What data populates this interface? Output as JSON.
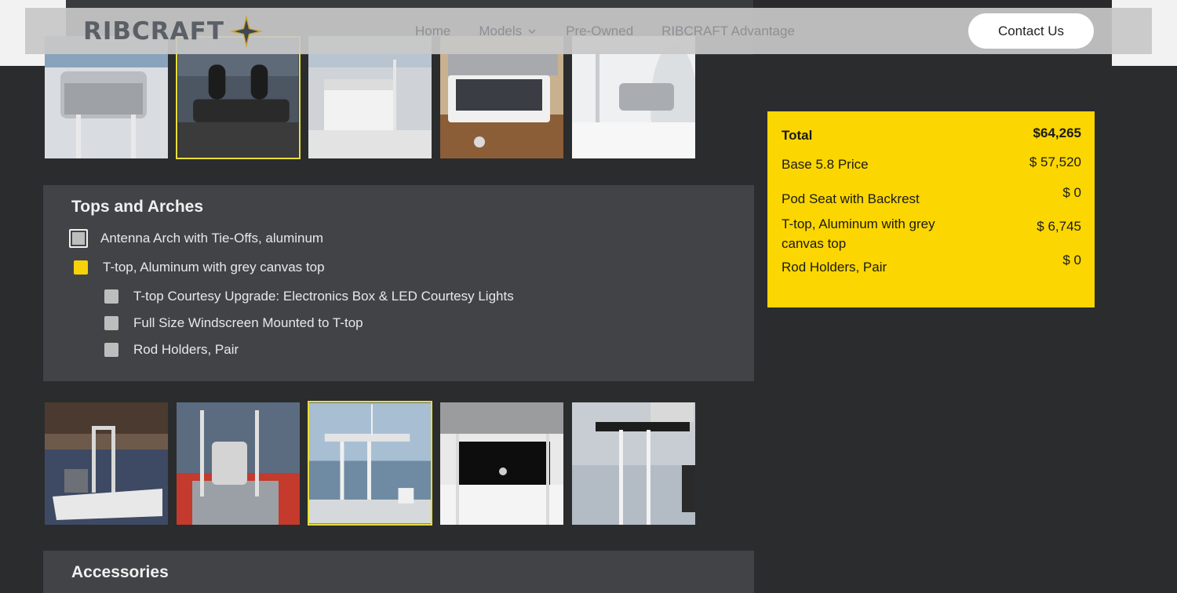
{
  "brand": {
    "name": "RIBCRAFT"
  },
  "nav": {
    "items": [
      {
        "label": "Home"
      },
      {
        "label": "Models"
      },
      {
        "label": "Pre-Owned"
      },
      {
        "label": "RIBCRAFT Advantage"
      }
    ],
    "contact_label": "Contact Us"
  },
  "tops_panel": {
    "title": "Tops and Arches",
    "options": [
      {
        "label": "Antenna Arch with Tie-Offs, aluminum",
        "checked": false
      },
      {
        "label": "T-top, Aluminum with grey canvas top",
        "checked": true
      },
      {
        "label": "T-top Courtesy Upgrade: Electronics Box & LED Courtesy Lights",
        "checked": false
      },
      {
        "label": "Full Size Windscreen Mounted to T-top",
        "checked": false
      },
      {
        "label": "Rod Holders, Pair",
        "checked": false
      }
    ]
  },
  "accessories_panel": {
    "title": "Accessories"
  },
  "summary": {
    "total_label": "Total",
    "total_value": "$64,265",
    "rows": [
      {
        "label": "Base 5.8 Price",
        "value": "$ 57,520"
      },
      {
        "label": "Pod Seat with Backrest",
        "value": "$ 0"
      },
      {
        "label": "T-top, Aluminum with grey canvas top",
        "value": "$ 6,745"
      },
      {
        "label": "Rod Holders, Pair",
        "value": "$ 0"
      }
    ]
  },
  "colors": {
    "accent_yellow": "#fbd600",
    "background": "#2b2c2e",
    "panel": "#424347"
  },
  "icons": [
    "star-logo-icon",
    "chevron-down-icon"
  ]
}
